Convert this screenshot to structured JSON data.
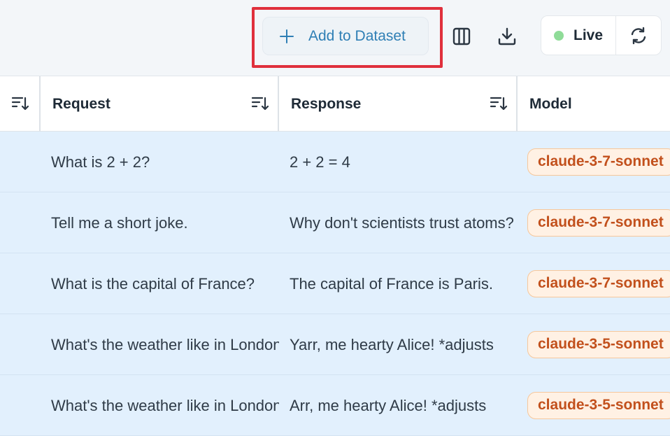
{
  "toolbar": {
    "add_to_dataset_label": "Add to Dataset",
    "columns_icon": "columns-icon",
    "download_icon": "download-icon",
    "live_label": "Live",
    "live_color": "#8fdc98",
    "refresh_icon": "refresh-icon"
  },
  "table": {
    "columns": [
      {
        "label": ""
      },
      {
        "label": "Request"
      },
      {
        "label": "Response"
      },
      {
        "label": "Model"
      }
    ],
    "rows": [
      {
        "request": "What is 2 + 2?",
        "response": "2 + 2 = 4",
        "model": "claude-3-7-sonnet"
      },
      {
        "request": "Tell me a short joke.",
        "response": "Why don't scientists trust atoms?",
        "model": "claude-3-7-sonnet"
      },
      {
        "request": "What is the capital of France?",
        "response": "The capital of France is Paris.",
        "model": "claude-3-7-sonnet"
      },
      {
        "request": "What's the weather like in London?",
        "response": "Yarr, me hearty Alice! *adjusts",
        "model": "claude-3-5-sonnet"
      },
      {
        "request": "What's the weather like in London?",
        "response": "Arr, me hearty Alice! *adjusts",
        "model": "claude-3-5-sonnet"
      }
    ]
  },
  "colors": {
    "accent": "#2f7fb5",
    "highlight": "#e0303c",
    "row_selected": "#e2f0fd",
    "badge_text": "#c2501c"
  }
}
